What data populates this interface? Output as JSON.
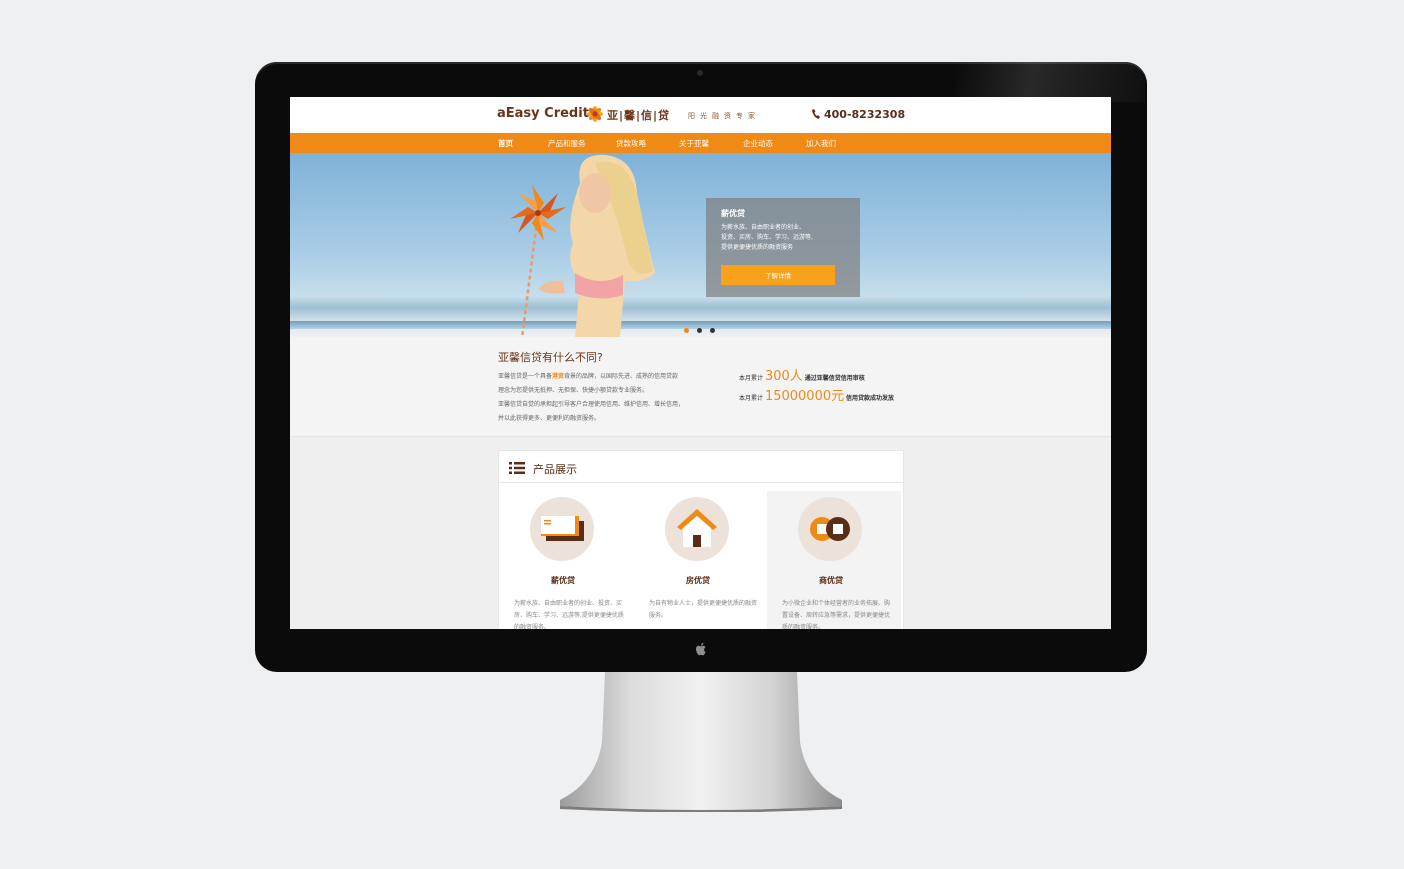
{
  "header": {
    "logo_en": "aEasy Credit",
    "logo_cn": "亚|馨|信|贷",
    "slogan": "阳光融资专家",
    "phone": "400-8232308"
  },
  "nav": {
    "items": [
      "首页",
      "产品和服务",
      "贷款攻略",
      "关于亚馨",
      "企业动态",
      "加入我们"
    ]
  },
  "banner": {
    "promo_title": "薪优贷",
    "promo_lines": [
      "为薪水族、自由职业者的创业、",
      "投资、买房、购车、学习、远游等,",
      "提供更便捷优质的融资服务"
    ],
    "promo_button": "了解详情",
    "slides": 3,
    "active_slide": 1
  },
  "intro": {
    "title": "亚馨信贷有什么不同?",
    "line1_a": "亚馨信贷是一个具备",
    "line1_hl": "港资",
    "line1_b": "背景的品牌，以国际先进、成熟的信用贷款",
    "line2": "理念为您提供无抵押、无担保、快捷小额贷款专业服务。",
    "line3": "亚馨信贷自觉的承担起引导客户合理使用信用、维护信用、增长信用，",
    "line4": "并以此获得更多、更便利的融资服务。"
  },
  "stats": [
    {
      "prefix": "本月累计",
      "value": "300人",
      "desc": "通过亚馨信贷信用审核"
    },
    {
      "prefix": "本月累计",
      "value": "15000000元",
      "desc": "信用贷款成功发放"
    }
  ],
  "products": {
    "title": "产品展示",
    "items": [
      {
        "name": "薪优贷",
        "desc": "为薪水族、自由职业者的创业、投资、买房、购车、学习、远游等,提供更便捷优质的融资服务。"
      },
      {
        "name": "房优贷",
        "desc": "为自有物业人士，提供更便捷优质的融资服务。"
      },
      {
        "name": "商优贷",
        "desc": "为小微企业和个体经营者的业务拓展、购置设备、周转应急等需求，提供更便捷优质的融资服务。"
      }
    ]
  },
  "colors": {
    "brand_orange": "#f08a16",
    "brand_brown": "#6b3418",
    "promo_button": "#f7a21a"
  },
  "icons": [
    "phone-icon",
    "flower-logo-icon",
    "list-icon",
    "wallet-icon",
    "house-icon",
    "coins-icon",
    "apple-logo-icon"
  ]
}
